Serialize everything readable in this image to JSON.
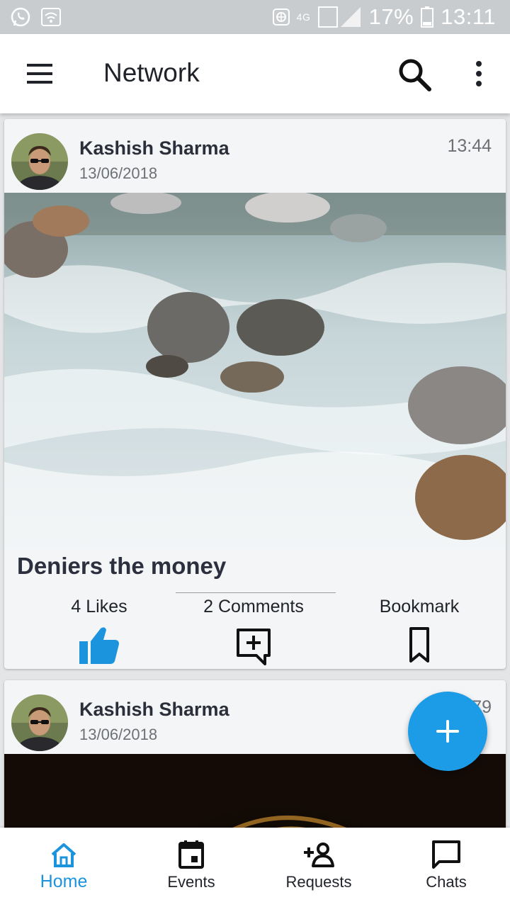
{
  "statusbar": {
    "battery": "17%",
    "time": "13:11",
    "network": "4G",
    "icons": [
      "whatsapp-icon",
      "wifi-icon",
      "vpn-icon",
      "signal-icon",
      "battery-icon"
    ]
  },
  "appbar": {
    "title": "Network",
    "icons": [
      "menu-icon",
      "search-icon",
      "more-vert-icon"
    ]
  },
  "posts": [
    {
      "author": "Kashish Sharma",
      "date": "13/06/2018",
      "time": "13:44",
      "image": "river-rapids-photo",
      "title": "Deniers the money",
      "likes_label": "4 Likes",
      "comments_label": "2 Comments",
      "bookmark_label": "Bookmark",
      "like_color": "#1b94dd"
    },
    {
      "author": "Kashish Sharma",
      "date": "13/06/2018",
      "time": "79",
      "image": "lamp-light-photo"
    }
  ],
  "fab": {
    "icon": "add-icon",
    "color": "#1c9be6"
  },
  "bottomnav": {
    "items": [
      {
        "label": "Home",
        "icon": "home-icon",
        "active": true
      },
      {
        "label": "Events",
        "icon": "calendar-icon",
        "active": false
      },
      {
        "label": "Requests",
        "icon": "person-add-icon",
        "active": false
      },
      {
        "label": "Chats",
        "icon": "chat-icon",
        "active": false
      }
    ],
    "active_color": "#1b94dd"
  }
}
